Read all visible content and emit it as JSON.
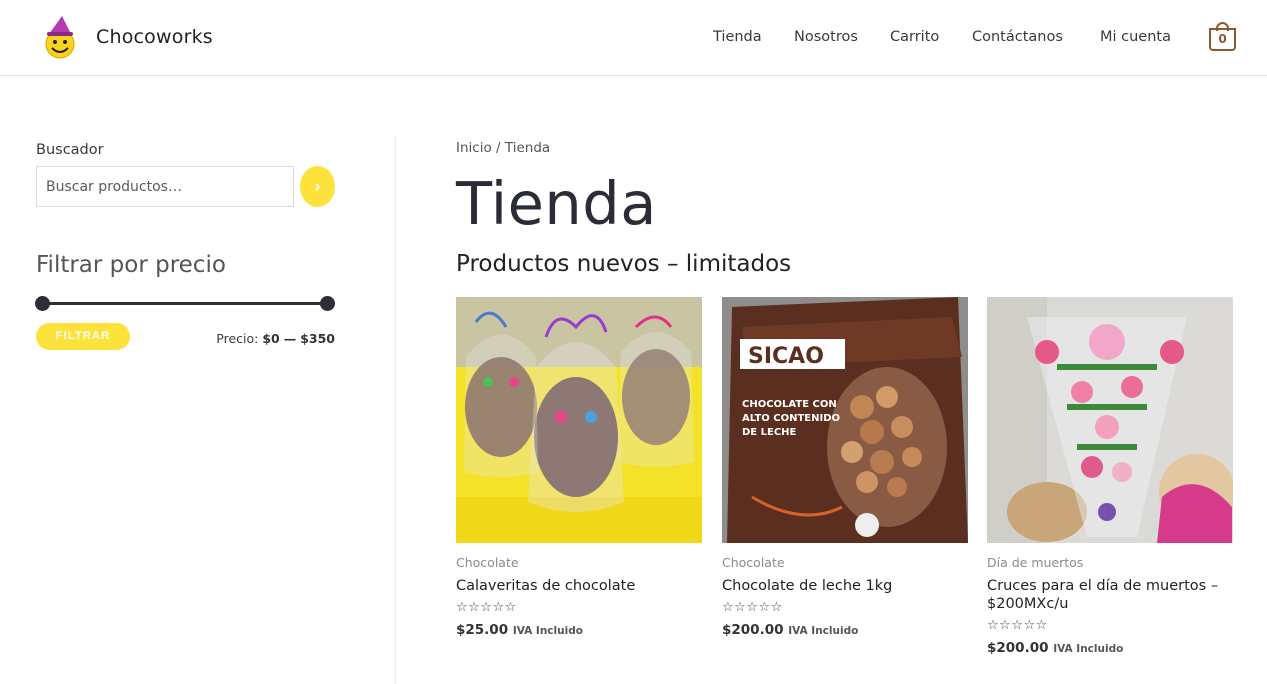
{
  "header": {
    "site_title": "Chocoworks",
    "nav": [
      "Tienda",
      "Nosotros",
      "Carrito",
      "Contáctanos",
      "Mi cuenta"
    ],
    "cart_count": "0"
  },
  "sidebar": {
    "search_label": "Buscador",
    "search_placeholder": "Buscar productos…",
    "search_button_glyph": "›",
    "filter_title": "Filtrar por precio",
    "filter_button": "FILTRAR",
    "price_label": "Precio:",
    "price_min": "$0",
    "price_sep": "—",
    "price_max": "$350",
    "slider_range": [
      0,
      1
    ]
  },
  "main": {
    "breadcrumb_home": "Inicio",
    "breadcrumb_sep": "/",
    "breadcrumb_current": "Tienda",
    "page_title": "Tienda",
    "section_title": "Productos nuevos – limitados",
    "products": [
      {
        "category": "Chocolate",
        "name": "Calaveritas de chocolate",
        "rating": "☆☆☆☆☆",
        "price": "$25.00",
        "tax": "IVA Incluido"
      },
      {
        "category": "Chocolate",
        "name": "Chocolate de leche 1kg",
        "rating": "☆☆☆☆☆",
        "price": "$200.00",
        "tax": "IVA Incluido"
      },
      {
        "category": "Día de muertos",
        "name": "Cruces para el día de muertos – $200MXc/u",
        "rating": "☆☆☆☆☆",
        "price": "$200.00",
        "tax": "IVA Incluido"
      }
    ]
  },
  "colors": {
    "accent": "#fde23c",
    "cart": "#8a5a2b",
    "title": "#2a2d38"
  },
  "icons": {
    "logo": "smiley-witch-logo",
    "cart": "shopping-bag-icon",
    "search": "chevron-right-icon"
  }
}
